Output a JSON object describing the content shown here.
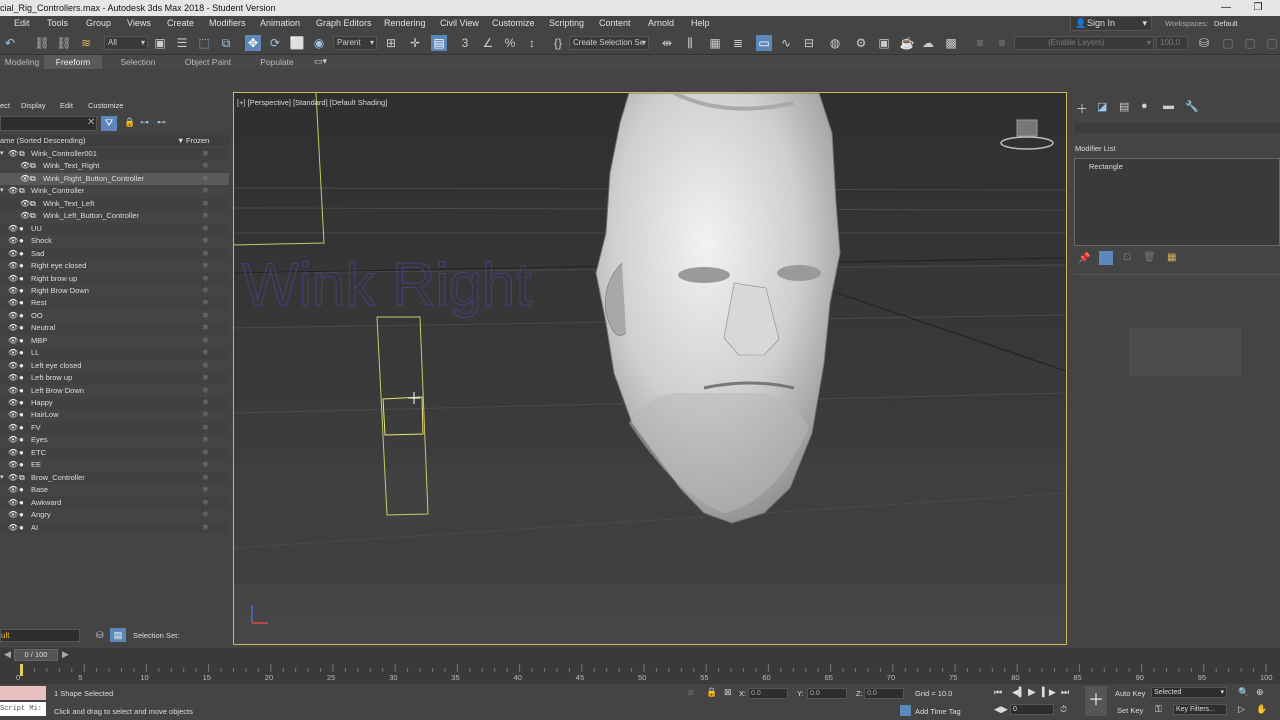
{
  "window": {
    "title": "cial_Rig_Controllers.max - Autodesk 3ds Max 2018 - Student Version",
    "minimize": "—",
    "restore": "❐"
  },
  "menus": [
    "Edit",
    "Tools",
    "Group",
    "Views",
    "Create",
    "Modifiers",
    "Animation",
    "Graph Editors",
    "Rendering",
    "Civil View",
    "Customize",
    "Scripting",
    "Content",
    "Arnold",
    "Help"
  ],
  "account": {
    "sign_in": "Sign In",
    "workspaces_label": "Workspaces:",
    "workspace_value": "Default"
  },
  "toolbar": {
    "filter_value": "All",
    "ref_coord_value": "Parent",
    "selection_set_placeholder": "Create Selection Se",
    "layers_placeholder": "(Enable Layers)",
    "percent_value": "100.0"
  },
  "ribbon_tabs": [
    {
      "label": "Modeling",
      "active": false
    },
    {
      "label": "Freeform",
      "active": true
    },
    {
      "label": "Selection",
      "active": false
    },
    {
      "label": "Object Paint",
      "active": false
    },
    {
      "label": "Populate",
      "active": false
    }
  ],
  "explorer": {
    "menu": [
      "ect",
      "Display",
      "Edit",
      "Customize"
    ],
    "column_name": "ame (Sorted Descending)",
    "column_frozen": "Frozen",
    "rows": [
      {
        "label": "Wink_Controller001",
        "indent": 1,
        "selected": false
      },
      {
        "label": "Wink_Text_Right",
        "indent": 2,
        "selected": false
      },
      {
        "label": "Wink_Right_Button_Controller",
        "indent": 2,
        "selected": true
      },
      {
        "label": "Wink_Controller",
        "indent": 1,
        "selected": false
      },
      {
        "label": "Wink_Text_Left",
        "indent": 2,
        "selected": false
      },
      {
        "label": "Wink_Left_Button_Controller",
        "indent": 2,
        "selected": false
      },
      {
        "label": "UU",
        "indent": 0,
        "selected": false
      },
      {
        "label": "Shock",
        "indent": 0,
        "selected": false
      },
      {
        "label": "Sad",
        "indent": 0,
        "selected": false
      },
      {
        "label": "Right eye closed",
        "indent": 0,
        "selected": false
      },
      {
        "label": "Right brow up",
        "indent": 0,
        "selected": false
      },
      {
        "label": "Right Brow Down",
        "indent": 0,
        "selected": false
      },
      {
        "label": "Rest",
        "indent": 0,
        "selected": false
      },
      {
        "label": "OO",
        "indent": 0,
        "selected": false
      },
      {
        "label": "Neutral",
        "indent": 0,
        "selected": false
      },
      {
        "label": "MBP",
        "indent": 0,
        "selected": false
      },
      {
        "label": "LL",
        "indent": 0,
        "selected": false
      },
      {
        "label": "Left eye closed",
        "indent": 0,
        "selected": false
      },
      {
        "label": "Left brow up",
        "indent": 0,
        "selected": false
      },
      {
        "label": "Left Brow Down",
        "indent": 0,
        "selected": false
      },
      {
        "label": "Happy",
        "indent": 0,
        "selected": false
      },
      {
        "label": "HairLow",
        "indent": 0,
        "selected": false
      },
      {
        "label": "FV",
        "indent": 0,
        "selected": false
      },
      {
        "label": "Eyes",
        "indent": 0,
        "selected": false
      },
      {
        "label": "ETC",
        "indent": 0,
        "selected": false
      },
      {
        "label": "EE",
        "indent": 0,
        "selected": false
      },
      {
        "label": "Brow_Controller",
        "indent": 1,
        "selected": false
      },
      {
        "label": "Base",
        "indent": 0,
        "selected": false
      },
      {
        "label": "Awkward",
        "indent": 0,
        "selected": false
      },
      {
        "label": "Angry",
        "indent": 0,
        "selected": false
      },
      {
        "label": "AI",
        "indent": 0,
        "selected": false
      }
    ],
    "layer_value": "ult",
    "selection_set_label": "Selection Set:"
  },
  "viewport": {
    "label": "[+] [Perspective] [Standard] [Default Shading]",
    "overlay_text": "Wink Right"
  },
  "command_panel": {
    "modifier_list": "Modifier List",
    "stack_item": "Rectangle"
  },
  "timeline": {
    "frame_readout": "0 / 100",
    "ticks": [
      "0",
      "5",
      "10",
      "15",
      "20",
      "25",
      "30",
      "35",
      "40",
      "45",
      "50",
      "55",
      "60",
      "65",
      "70",
      "75",
      "80",
      "85",
      "90",
      "95",
      "100"
    ]
  },
  "status": {
    "script_label": "Script Mi:",
    "selection_info": "1 Shape Selected",
    "prompt": "Click and drag to select and move objects",
    "x_label": "X:",
    "y_label": "Y:",
    "z_label": "Z:",
    "x_value": "0.0",
    "y_value": "0.0",
    "z_value": "0.0",
    "grid": "Grid = 10.0",
    "add_time_tag": "Add Time Tag",
    "frame_value": "0",
    "auto_key": "Auto Key",
    "selected_value": "Selected",
    "set_key": "Set Key",
    "key_filters": "Key Filters..."
  }
}
